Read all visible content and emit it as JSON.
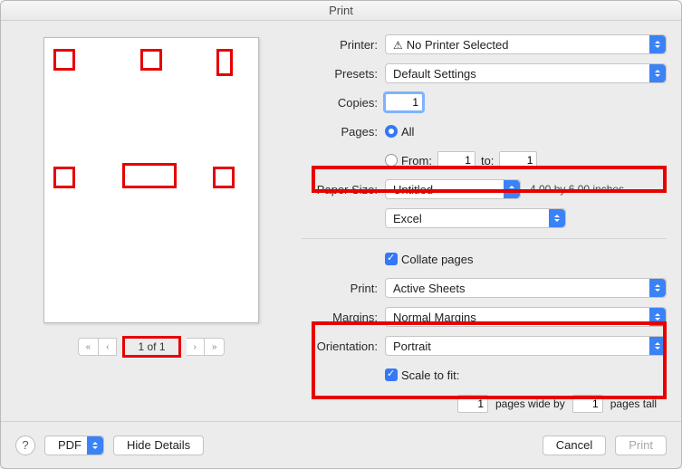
{
  "title": "Print",
  "preview": {
    "pager_label": "1 of 1"
  },
  "form": {
    "printer_label": "Printer:",
    "printer_value": "No Printer Selected",
    "presets_label": "Presets:",
    "presets_value": "Default Settings",
    "copies_label": "Copies:",
    "copies_value": "1",
    "pages_label": "Pages:",
    "pages_all": "All",
    "pages_from": "From:",
    "pages_from_val": "1",
    "pages_to": "to:",
    "pages_to_val": "1",
    "paper_label": "Paper Size:",
    "paper_value": "Untitled",
    "paper_dims": "4.00 by 6.00 inches",
    "app_value": "Excel",
    "collate": "Collate pages",
    "print_label": "Print:",
    "print_value": "Active Sheets",
    "margins_label": "Margins:",
    "margins_value": "Normal Margins",
    "orient_label": "Orientation:",
    "orient_value": "Portrait",
    "scale_label": "Scale to fit:",
    "scale_wide_val": "1",
    "scale_wide_txt": "pages wide by",
    "scale_tall_val": "1",
    "scale_tall_txt": "pages tall"
  },
  "footer": {
    "help": "?",
    "pdf": "PDF",
    "hide": "Hide Details",
    "cancel": "Cancel",
    "print": "Print"
  }
}
